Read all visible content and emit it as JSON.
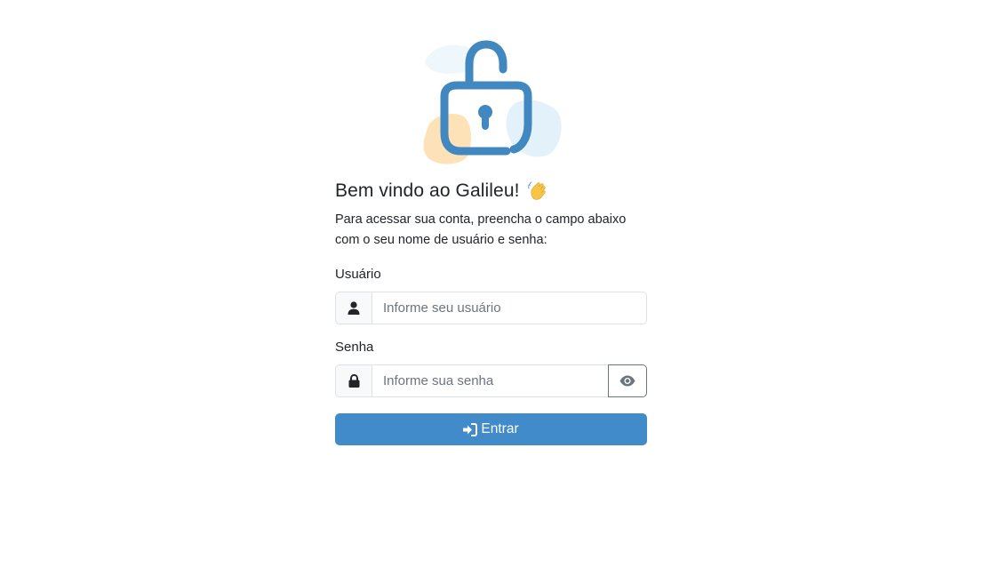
{
  "login": {
    "title": "Bem vindo ao Galileu!",
    "wave_icon": "waving-hand-icon",
    "intro": "Para acessar sua conta, preencha o campo abaixo com o seu nome de usuário e senha:",
    "username": {
      "label": "Usuário",
      "placeholder": "Informe seu usuário",
      "icon": "user-icon"
    },
    "password": {
      "label": "Senha",
      "placeholder": "Informe sua senha",
      "icon": "lock-icon",
      "toggle_icon": "eye-icon"
    },
    "submit": {
      "label": "Entrar",
      "icon": "sign-in-icon"
    }
  },
  "illustration": "unlocked-padlock-icon",
  "colors": {
    "accent": "#428bca",
    "padlock": "#4288c0",
    "blob_orange": "#fde2b8",
    "blob_blue": "#e3f2fa",
    "text": "#212529"
  }
}
